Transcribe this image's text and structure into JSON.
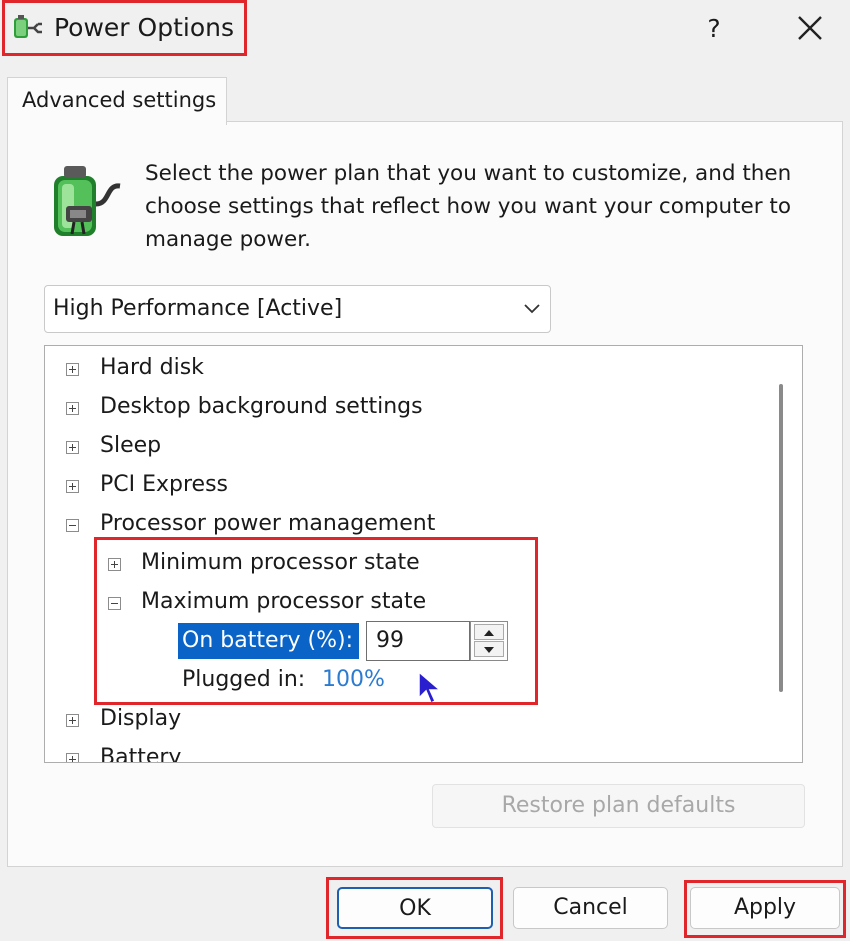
{
  "window": {
    "title": "Power Options",
    "help_label": "?",
    "icons": {
      "app": "power-plug-icon",
      "close": "close-icon"
    }
  },
  "tabs": [
    {
      "label": "Advanced settings",
      "selected": true
    }
  ],
  "description": "Select the power plan that you want to customize, and then choose settings that reflect how you want your computer to manage power.",
  "plan_select": {
    "value": "High Performance [Active]"
  },
  "tree": {
    "items": [
      {
        "label": "Hard disk",
        "expanded": false
      },
      {
        "label": "Desktop background settings",
        "expanded": false
      },
      {
        "label": "Sleep",
        "expanded": false
      },
      {
        "label": "PCI Express",
        "expanded": false
      },
      {
        "label": "Processor power management",
        "expanded": true
      },
      {
        "label": "Minimum processor state",
        "expanded": false
      },
      {
        "label": "Maximum processor state",
        "expanded": true
      },
      {
        "label": "Display",
        "expanded": false
      },
      {
        "label": "Battery",
        "expanded": false
      }
    ],
    "on_battery": {
      "label": "On battery (%):",
      "value": "99"
    },
    "plugged_in": {
      "label": "Plugged in:",
      "value": "100%"
    }
  },
  "buttons": {
    "restore": "Restore plan defaults",
    "ok": "OK",
    "cancel": "Cancel",
    "apply": "Apply"
  },
  "colors": {
    "highlight_box": "#e0262b",
    "selection": "#0a64c8",
    "link_value": "#2b7bd0"
  }
}
